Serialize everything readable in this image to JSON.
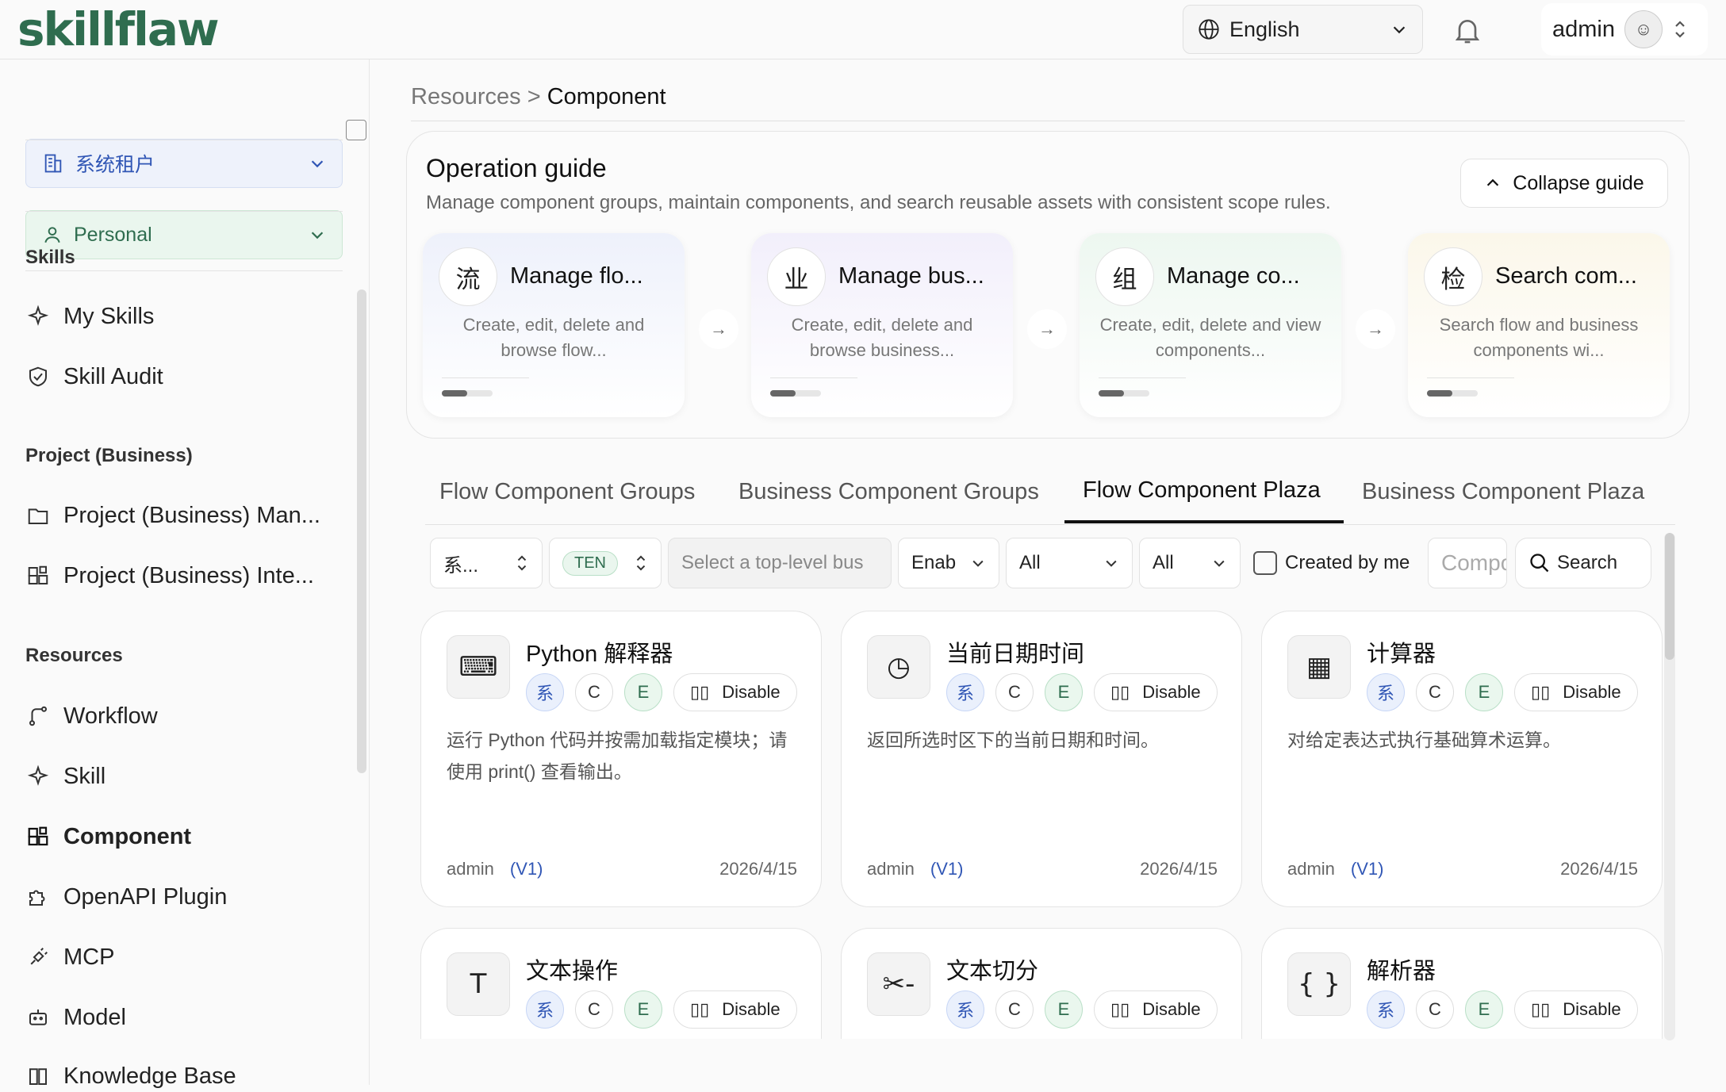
{
  "header": {
    "logo": "skillflaw",
    "language": "English",
    "user": "admin"
  },
  "sidebar": {
    "tenant": "系统租户",
    "scope": "Personal",
    "sections": [
      {
        "title": "Skills",
        "items": [
          "My Skills",
          "Skill Audit"
        ]
      },
      {
        "title": "Project (Business)",
        "items": [
          "Project (Business) Man...",
          "Project (Business) Inte..."
        ]
      },
      {
        "title": "Resources",
        "items": [
          "Workflow",
          "Skill",
          "Component",
          "OpenAPI Plugin",
          "MCP",
          "Model",
          "Knowledge Base"
        ]
      }
    ],
    "active": "Component"
  },
  "breadcrumb": {
    "parent": "Resources",
    "separator": ">",
    "current": "Component"
  },
  "guide": {
    "title": "Operation guide",
    "desc": "Manage component groups, maintain components, and search reusable assets with consistent scope rules.",
    "collapse_label": "Collapse guide",
    "steps": [
      {
        "badge": "流",
        "title": "Manage flo...",
        "desc": "Create, edit, delete and browse flow...",
        "color": "#eef1fb"
      },
      {
        "badge": "业",
        "title": "Manage bus...",
        "desc": "Create, edit, delete and browse business...",
        "color": "#f2effb"
      },
      {
        "badge": "组",
        "title": "Manage co...",
        "desc": "Create, edit, delete and view components...",
        "color": "#edf7f0"
      },
      {
        "badge": "检",
        "title": "Search com...",
        "desc": "Search flow and business components wi...",
        "color": "#fbf7ea"
      }
    ]
  },
  "tabs": [
    "Flow Component Groups",
    "Business Component Groups",
    "Flow Component Plaza",
    "Business Component Plaza"
  ],
  "active_tab": "Flow Component Plaza",
  "filters": {
    "scope": "系...",
    "tenant_tag": "TEN",
    "business_placeholder": "Select a top-level bus",
    "status": "Enab",
    "type1": "All",
    "type2": "All",
    "created_by_me": "Created by me",
    "search_placeholder": "Components",
    "search_button": "Search"
  },
  "cards": [
    {
      "icon": "terminal-icon",
      "glyph": "⌨",
      "name": "Python 解释器",
      "sys": "系",
      "c": "C",
      "e": "E",
      "toggle": "Disable",
      "desc": "运行 Python 代码并按需加载指定模块；请使用 print() 查看输出。",
      "author": "admin",
      "version": "(V1)",
      "date": "2026/4/15"
    },
    {
      "icon": "clock-icon",
      "glyph": "◷",
      "name": "当前日期时间",
      "sys": "系",
      "c": "C",
      "e": "E",
      "toggle": "Disable",
      "desc": "返回所选时区下的当前日期和时间。",
      "author": "admin",
      "version": "(V1)",
      "date": "2026/4/15"
    },
    {
      "icon": "calculator-icon",
      "glyph": "▦",
      "name": "计算器",
      "sys": "系",
      "c": "C",
      "e": "E",
      "toggle": "Disable",
      "desc": "对给定表达式执行基础算术运算。",
      "author": "admin",
      "version": "(V1)",
      "date": "2026/4/15"
    },
    {
      "icon": "text-icon",
      "glyph": "T",
      "name": "文本操作",
      "sys": "系",
      "c": "C",
      "e": "E",
      "toggle": "Disable",
      "desc": "",
      "author": "",
      "version": "",
      "date": ""
    },
    {
      "icon": "scissors-icon",
      "glyph": "✂-",
      "name": "文本切分",
      "sys": "系",
      "c": "C",
      "e": "E",
      "toggle": "Disable",
      "desc": "",
      "author": "",
      "version": "",
      "date": ""
    },
    {
      "icon": "braces-icon",
      "glyph": "{ }",
      "name": "解析器",
      "sys": "系",
      "c": "C",
      "e": "E",
      "toggle": "Disable",
      "desc": "",
      "author": "",
      "version": "",
      "date": ""
    }
  ]
}
